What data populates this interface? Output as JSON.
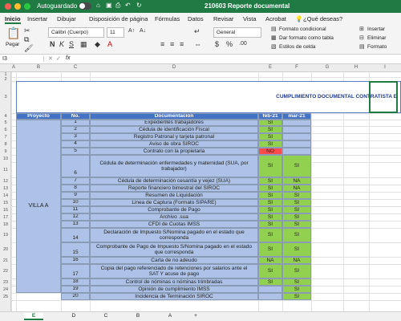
{
  "app": {
    "autosave_label": "Autoguardado",
    "autosave_state": "OFF",
    "title": "210603 Reporte documental"
  },
  "ribbon_tabs": [
    "Inicio",
    "Insertar",
    "Dibujar",
    "Disposición de página",
    "Fórmulas",
    "Datos",
    "Revisar",
    "Vista",
    "Acrobat",
    "¿Qué deseas?"
  ],
  "ribbon": {
    "paste_label": "Pegar",
    "font_name": "Calibri (Cuerpo)",
    "font_size": "11",
    "number_format": "General",
    "conditional_format": "Formato condicional",
    "format_as_table": "Dar formato como tabla",
    "cell_styles": "Estilos de celda",
    "insert": "Insertar",
    "delete": "Eliminar",
    "format": "Formato"
  },
  "formula_bar": {
    "name_box": "I3",
    "fx": "fx",
    "value": ""
  },
  "columns": [
    "A",
    "B",
    "C",
    "D",
    "E",
    "F",
    "G",
    "H",
    "I"
  ],
  "rows": [
    "1",
    "2",
    "3",
    "4",
    "5",
    "6",
    "7",
    "8",
    "9",
    "10",
    "11",
    "12",
    "13",
    "14",
    "15",
    "16",
    "17",
    "18",
    "19",
    "20",
    "21",
    "22",
    "23",
    "24",
    "25"
  ],
  "sheet_title": "CUMPLIMIENTO DOCUMENTAL CONTRATISTA E",
  "headers": {
    "project": "Proyecto",
    "no": "No.",
    "doc": "Documentación",
    "feb": "feb-21",
    "mar": "mar-21"
  },
  "project_name": "VILLA  A",
  "table": [
    {
      "no": "1",
      "doc": "Expedientes trabajadores",
      "feb": "SI",
      "mar": ""
    },
    {
      "no": "2",
      "doc": "Cédula de identificación Fiscal",
      "feb": "SI",
      "mar": ""
    },
    {
      "no": "3",
      "doc": "Registro Patronal y tarjeta patronal",
      "feb": "SI",
      "mar": ""
    },
    {
      "no": "4",
      "doc": "Aviso de obra SIROC",
      "feb": "SI",
      "mar": ""
    },
    {
      "no": "5",
      "doc": "Contrato con la propietaria",
      "feb": "NO",
      "mar": ""
    },
    {
      "no": "6",
      "doc": "Cédula de determinación enfermedades y maternidad (SUA, por trabajador)",
      "feb": "SI",
      "mar": "SI"
    },
    {
      "no": "7",
      "doc": "Cédula de determinación cesantía y vejez (SUA)",
      "feb": "SI",
      "mar": "NA"
    },
    {
      "no": "8",
      "doc": "Reporte financiero bimestral del SIROC",
      "feb": "SI",
      "mar": "NA"
    },
    {
      "no": "9",
      "doc": "Resumen de Liquidación",
      "feb": "SI",
      "mar": "SI"
    },
    {
      "no": "10",
      "doc": "Linea de Captura (Formato SIPARE)",
      "feb": "SI",
      "mar": "SI"
    },
    {
      "no": "11",
      "doc": "Comprobante de Pago",
      "feb": "SI",
      "mar": "SI"
    },
    {
      "no": "12",
      "doc": "Archivo .sua",
      "feb": "SI",
      "mar": "SI"
    },
    {
      "no": "13",
      "doc": "CFDI de Cuotas IMSS",
      "feb": "SI",
      "mar": "SI"
    },
    {
      "no": "14",
      "doc": "Declaración de Impuesto S/Nomina pagado en el estado que corresponda",
      "feb": "SI",
      "mar": "SI"
    },
    {
      "no": "15",
      "doc": "Comprobante de Pago de Impuesto S/Nomina pagado en el estado que corresponda",
      "feb": "SI",
      "mar": "SI"
    },
    {
      "no": "16",
      "doc": "Carta de no adeudo",
      "feb": "NA",
      "mar": "NA"
    },
    {
      "no": "17",
      "doc": "Copia del pago referenciado de retenciones por salarios ante el SAT Y acuse de pago",
      "feb": "SI",
      "mar": "SI"
    },
    {
      "no": "18",
      "doc": "Control de nóminas o nóminas trimbradas",
      "feb": "SI",
      "mar": "SI"
    },
    {
      "no": "19",
      "doc": "Opinión de cumplimiento IMSS",
      "feb": "",
      "mar": "SI"
    },
    {
      "no": "20",
      "doc": "Incidencia de Terminación SIROC",
      "feb": "",
      "mar": "SI"
    }
  ],
  "sheet_tabs": [
    "E",
    "D",
    "C",
    "B",
    "A",
    "+"
  ],
  "active_sheet": "E",
  "colors": {
    "green": "#92d050",
    "red": "#ff4b4b",
    "blue": "#adc2e6",
    "header": "#4472c4",
    "excel": "#1f7a44"
  }
}
